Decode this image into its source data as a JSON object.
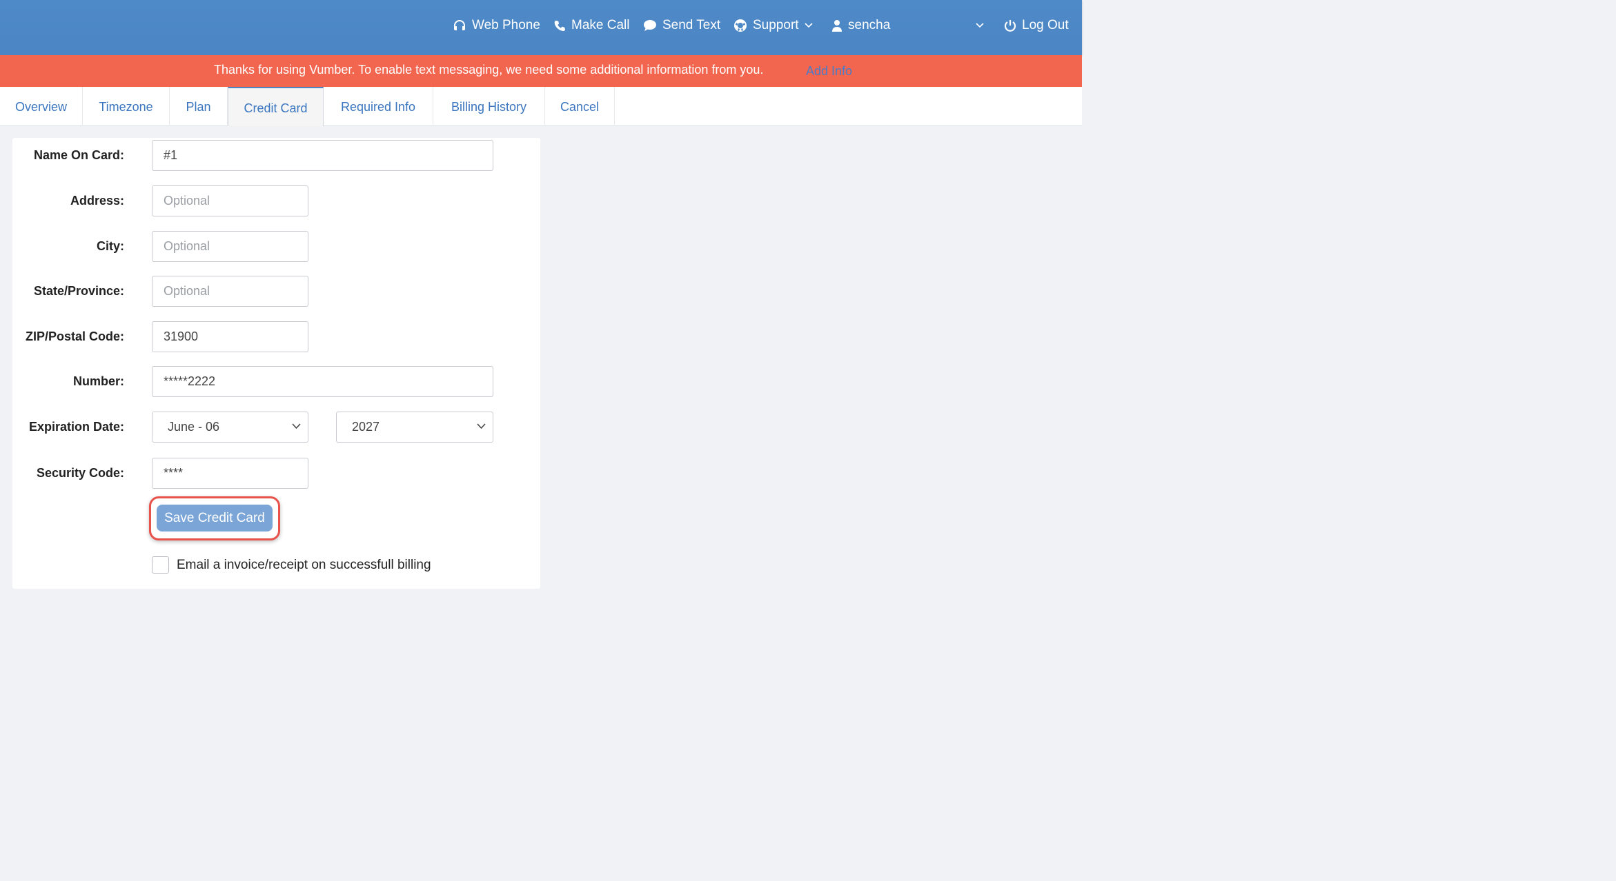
{
  "header": {
    "nav": [
      {
        "label": "Web Phone",
        "icon": "headset-icon"
      },
      {
        "label": "Make Call",
        "icon": "phone-icon"
      },
      {
        "label": "Send Text",
        "icon": "chat-bubble-icon"
      },
      {
        "label": "Support",
        "icon": "lifebuoy-icon"
      },
      {
        "label": "sencha",
        "icon": "user-icon"
      },
      {
        "label": "Log Out",
        "icon": "power-icon"
      }
    ]
  },
  "banner": {
    "message": "Thanks for using Vumber. To enable text messaging, we need some additional information from you.",
    "link": "Add Info"
  },
  "tabs": [
    {
      "label": "Overview"
    },
    {
      "label": "Timezone"
    },
    {
      "label": "Plan"
    },
    {
      "label": "Credit Card",
      "active": true
    },
    {
      "label": "Required Info"
    },
    {
      "label": "Billing History"
    },
    {
      "label": "Cancel"
    }
  ],
  "form": {
    "name_label": "Name On Card:",
    "name_value": "#1",
    "address_label": "Address:",
    "address_placeholder": "Optional",
    "city_label": "City:",
    "city_placeholder": "Optional",
    "state_label": "State/Province:",
    "state_placeholder": "Optional",
    "zip_label": "ZIP/Postal Code:",
    "zip_value": "31900",
    "number_label": "Number:",
    "number_value": "*****2222",
    "expiration_label": "Expiration Date:",
    "exp_month": "June - 06",
    "exp_year": "2027",
    "security_label": "Security Code:",
    "security_value": "****",
    "save_label": "Save Credit Card",
    "email_checkbox_label": "Email a invoice/receipt on successfull billing",
    "email_checked": false
  },
  "colors": {
    "header_bg": "#4b85c4",
    "banner_bg": "#f26650",
    "link": "#3a76bf",
    "save_button": "#7aa5d6",
    "highlight_ring": "#e8524a"
  }
}
